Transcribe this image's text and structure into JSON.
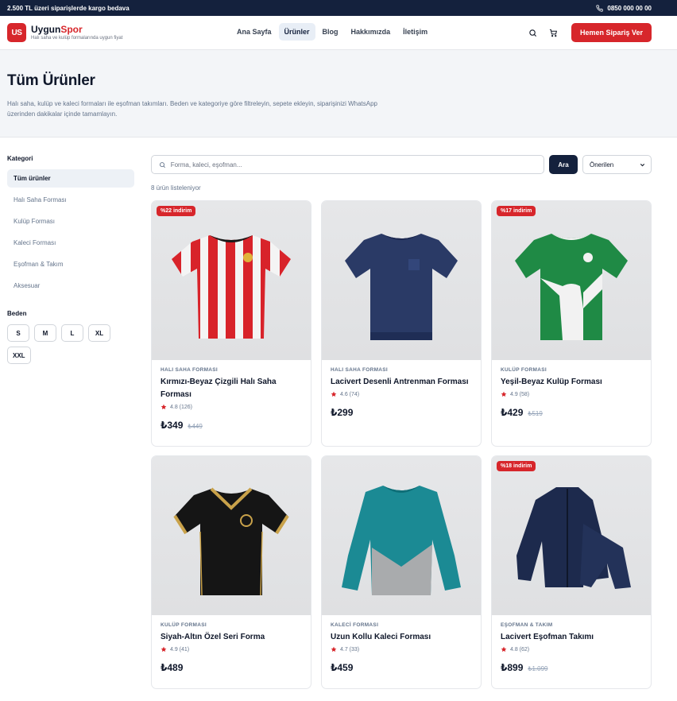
{
  "topbar": {
    "promo": "2.500 TL üzeri siparişlerde kargo bedava",
    "phone": "0850 000 00 00",
    "phone_icon": "phone-icon"
  },
  "header": {
    "logo_badge": "US",
    "brand_a": "Uygun",
    "brand_b": "Spor",
    "tagline": "Halı saha ve kulüp formalarında uygun fiyat",
    "nav": [
      "Ana Sayfa",
      "Ürünler",
      "Blog",
      "Hakkımızda",
      "İletişim"
    ],
    "active_nav": "Ürünler",
    "cta": "Hemen Sipariş Ver"
  },
  "hero": {
    "title": "Tüm Ürünler",
    "description": "Halı saha, kulüp ve kaleci formaları ile eşofman takımları. Beden ve kategoriye göre filtreleyin, sepete ekleyin, siparişinizi WhatsApp üzerinden dakikalar içinde tamamlayın."
  },
  "sidebar": {
    "category_heading": "Kategori",
    "categories": [
      "Tüm ürünler",
      "Halı Saha Forması",
      "Kulüp Forması",
      "Kaleci Forması",
      "Eşofman & Takım",
      "Aksesuar"
    ],
    "size_heading": "Beden",
    "sizes": [
      "S",
      "M",
      "L",
      "XL",
      "XXL"
    ]
  },
  "search": {
    "placeholder": "Forma, kaleci, eşofman...",
    "button": "Ara",
    "sort": "Önerilen"
  },
  "results_count": "8 ürün listeleniyor",
  "products": [
    {
      "badge": "%22 indirim",
      "category": "HALI SAHA FORMASI",
      "name": "Kırmızı-Beyaz Çizgili Halı Saha Forması",
      "rating": "4.8 (126)",
      "price": "₺349",
      "old_price": "₺449"
    },
    {
      "badge": "",
      "category": "HALI SAHA FORMASI",
      "name": "Lacivert Desenli Antrenman Forması",
      "rating": "4.6 (74)",
      "price": "₺299",
      "old_price": ""
    },
    {
      "badge": "%17 indirim",
      "category": "KULÜP FORMASI",
      "name": "Yeşil-Beyaz Kulüp Forması",
      "rating": "4.9 (58)",
      "price": "₺429",
      "old_price": "₺519"
    },
    {
      "badge": "",
      "category": "KULÜP FORMASI",
      "name": "Siyah-Altın Özel Seri Forma",
      "rating": "4.9 (41)",
      "price": "₺489",
      "old_price": ""
    },
    {
      "badge": "",
      "category": "KALECİ FORMASI",
      "name": "Uzun Kollu Kaleci Forması",
      "rating": "4.7 (33)",
      "price": "₺459",
      "old_price": ""
    },
    {
      "badge": "%18 indirim",
      "category": "EŞOFMAN & TAKIM",
      "name": "Lacivert Eşofman Takımı",
      "rating": "4.8 (62)",
      "price": "₺899",
      "old_price": "₺1.099"
    }
  ],
  "colors": {
    "brand_red": "#d7262b",
    "navy": "#14213d"
  }
}
